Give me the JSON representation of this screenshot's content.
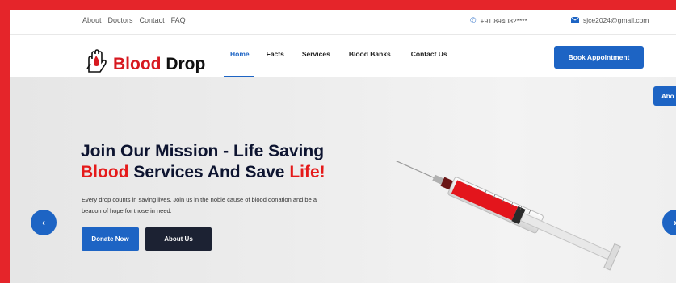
{
  "topbar": {
    "links": [
      "About",
      "Doctors",
      "Contact",
      "FAQ"
    ],
    "phone": "+91 894082****",
    "email": "sjce2024@gmail.com"
  },
  "brand": {
    "name_red": "Blood",
    "name_dark": "Drop"
  },
  "nav": {
    "items": [
      "Home",
      "Facts",
      "Services",
      "Blood Banks",
      "Contact Us"
    ],
    "active": "Home",
    "cta": "Book Appointment"
  },
  "hero": {
    "title_line1": "Join Our Mission - Life Saving",
    "title_red1": "Blood",
    "title_mid": " Services And Save ",
    "title_red2": "Life!",
    "description_line1": "Every drop counts in saving lives. Join us in the noble cause of blood donation and be a",
    "description_line2": "beacon of hope for those in need.",
    "primary_button": "Donate Now",
    "secondary_button": "About Us",
    "side_tab": "Abo"
  },
  "colors": {
    "accent": "#1d64c4",
    "brand_red": "#d71920",
    "dark": "#1c2233",
    "border": "#e5252a"
  },
  "icons": {
    "phone": "phone-icon",
    "email": "envelope-icon",
    "prev": "chevron-left-icon",
    "next": "chevron-right-icon"
  }
}
